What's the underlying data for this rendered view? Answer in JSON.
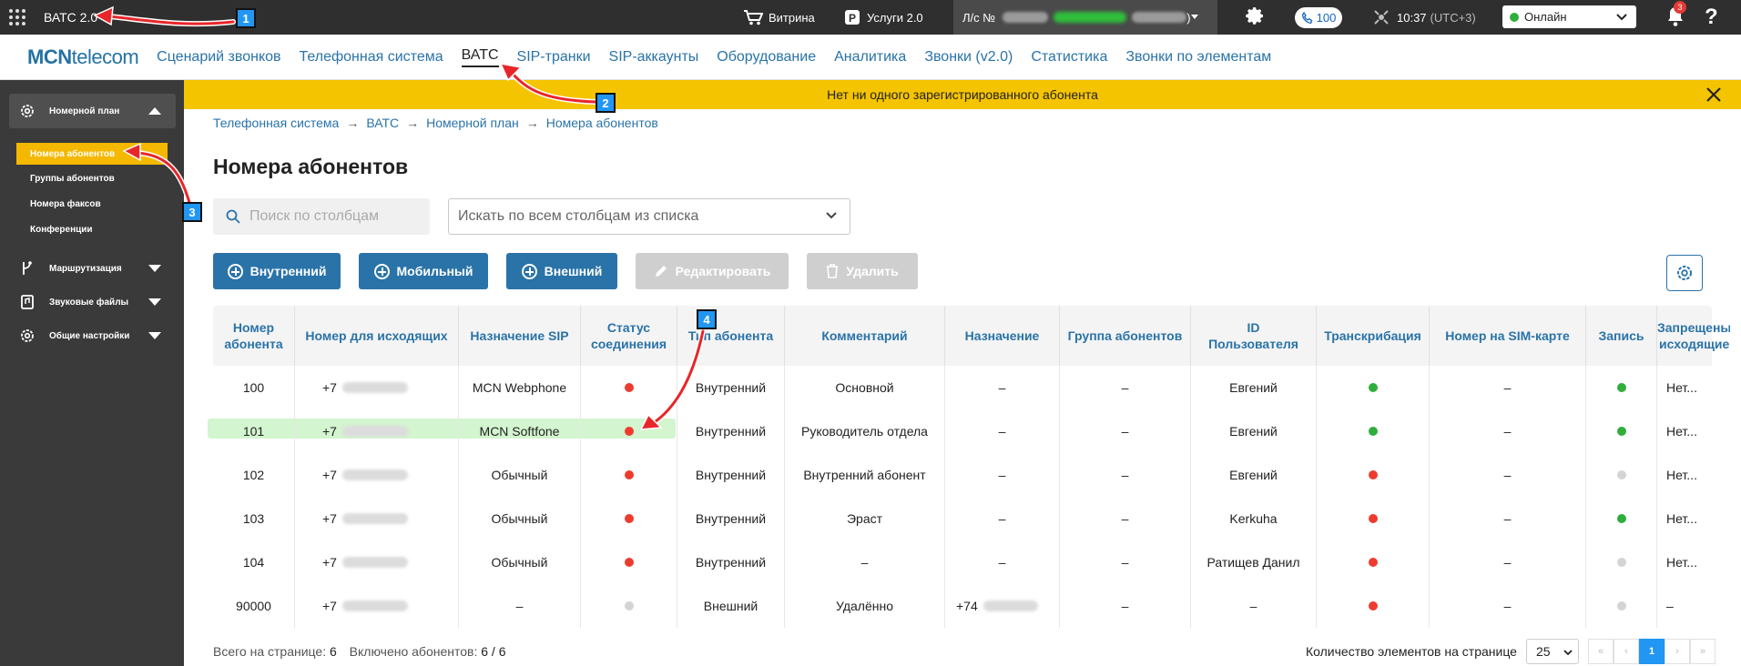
{
  "topbar": {
    "app_title": "ВАТС 2.0",
    "vitrina": "Витрина",
    "services": "Услуги 2.0",
    "ls_label": "Л/с №",
    "ls_tail": ") ",
    "call_count": "100",
    "time": "10:37",
    "tz": "(UTC+3)",
    "status": "Онлайн",
    "notif_count": "3",
    "help": "?"
  },
  "nav": {
    "logo_bold": "MCN",
    "logo_rest": "telecom",
    "links": [
      "Сценарий звонков",
      "Телефонная система",
      "ВАТС",
      "SIP-транки",
      "SIP-аккаунты",
      "Оборудование",
      "Аналитика",
      "Звонки (v2.0)",
      "Статистика",
      "Звонки по элементам"
    ]
  },
  "sidebar": {
    "group1": "Номерной план",
    "subs": [
      "Номера абонентов",
      "Группы абонентов",
      "Номера факсов",
      "Конференции"
    ],
    "group2": "Маршрутизация",
    "group3": "Звуковые файлы",
    "group4": "Общие настройки"
  },
  "banner": "Нет ни одного зарегистрированного абонента",
  "breadcrumb": [
    "Телефонная система",
    "ВАТС",
    "Номерной план",
    "Номера абонентов"
  ],
  "page_title": "Номера абонентов",
  "search": {
    "placeholder": "Поиск по столбцам"
  },
  "select": {
    "placeholder": "Искать по всем столбцам из списка"
  },
  "buttons": {
    "internal": "Внутренний",
    "mobile": "Мобильный",
    "external": "Внешний",
    "edit": "Редактировать",
    "delete": "Удалить"
  },
  "table": {
    "headers": [
      "Номер абонента",
      "Номер для исходящих",
      "Назначение SIP",
      "Статус соединения",
      "Тип абонента",
      "Комментарий",
      "Назначение",
      "Группа абонентов",
      "ID Пользователя",
      "Транскрибация",
      "Номер на SIM-карте",
      "Запись",
      "Запрещены исходящие"
    ],
    "rows": [
      {
        "num": "100",
        "out": "+7",
        "sip": "MCN Webphone",
        "conn": "red",
        "type": "Внутренний",
        "comment": "Основной",
        "dest": "–",
        "group": "–",
        "user": "Евгений",
        "transcr": "green",
        "sim": "–",
        "rec": "green",
        "forbid": "Нет..."
      },
      {
        "num": "101",
        "out": "+7",
        "sip": "MCN Softfone",
        "conn": "red",
        "type": "Внутренний",
        "comment": "Руководитель отдела",
        "dest": "–",
        "group": "–",
        "user": "Евгений",
        "transcr": "green",
        "sim": "–",
        "rec": "green",
        "forbid": "Нет..."
      },
      {
        "num": "102",
        "out": "+7",
        "sip": "Обычный",
        "conn": "red",
        "type": "Внутренний",
        "comment": "Внутренний абонент",
        "dest": "–",
        "group": "–",
        "user": "Евгений",
        "transcr": "red",
        "sim": "–",
        "rec": "grey",
        "forbid": "Нет..."
      },
      {
        "num": "103",
        "out": "+7",
        "sip": "Обычный",
        "conn": "red",
        "type": "Внутренний",
        "comment": "Эраст",
        "dest": "–",
        "group": "–",
        "user": "Kerkuha",
        "transcr": "red",
        "sim": "–",
        "rec": "green",
        "forbid": "Нет..."
      },
      {
        "num": "104",
        "out": "+7",
        "sip": "Обычный",
        "conn": "red",
        "type": "Внутренний",
        "comment": "–",
        "dest": "–",
        "group": "–",
        "user": "Ратищев Данил",
        "transcr": "red",
        "sim": "–",
        "rec": "grey",
        "forbid": "Нет..."
      },
      {
        "num": "90000",
        "out": "+7",
        "sip": "–",
        "conn": "grey",
        "type": "Внешний",
        "comment": "Удалённо",
        "dest": "+74",
        "group": "–",
        "user": "–",
        "transcr": "red",
        "sim": "–",
        "rec": "grey",
        "forbid": "–"
      }
    ]
  },
  "footer": {
    "total_label": "Всего на странице:",
    "total_value": "6",
    "included_label": "Включено абонентов:",
    "included_value": "6 / 6",
    "per_page_label": "Количество элементов на странице",
    "per_page": "25",
    "page": "1"
  },
  "annotations": [
    "1",
    "2",
    "3",
    "4"
  ],
  "colors": {
    "accent": "#2a73a8",
    "banner": "#f5c400",
    "active_sub": "#f5b800",
    "arrow": "#e8262a"
  }
}
